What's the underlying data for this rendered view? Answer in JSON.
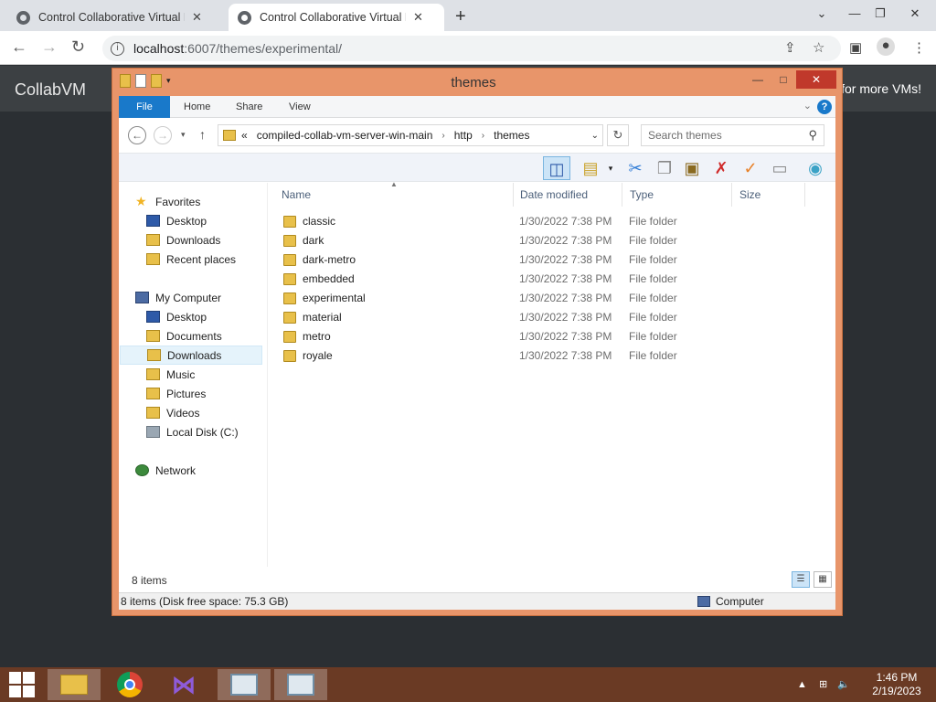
{
  "browser": {
    "tabs": [
      {
        "title": "Control Collaborative Virtual Ma",
        "close": "✕"
      },
      {
        "title": "Control Collaborative Virtual Ma",
        "close": "✕"
      }
    ],
    "new_tab": "+",
    "window_controls": [
      "⌄",
      "—",
      "❐",
      "✕"
    ],
    "url_host": "localhost",
    "url_rest": ":6007/themes/experimental/"
  },
  "site": {
    "logo": "CollabVM",
    "more_vms": "for more VMs!"
  },
  "explorer": {
    "title": "themes",
    "ribbon_tabs": [
      "File",
      "Home",
      "Share",
      "View"
    ],
    "help": "?",
    "breadcrumb": {
      "overflow": "«",
      "segments": [
        "compiled-collab-vm-server-win-main",
        "http",
        "themes"
      ]
    },
    "search_placeholder": "Search themes",
    "nav": {
      "favorites": "Favorites",
      "favorites_items": [
        "Desktop",
        "Downloads",
        "Recent places"
      ],
      "computer": "My Computer",
      "computer_items": [
        "Desktop",
        "Documents",
        "Downloads",
        "Music",
        "Pictures",
        "Videos",
        "Local Disk (C:)"
      ],
      "network": "Network"
    },
    "columns": [
      "Name",
      "Date modified",
      "Type",
      "Size"
    ],
    "files": [
      {
        "name": "classic",
        "date": "1/30/2022 7:38 PM",
        "type": "File folder"
      },
      {
        "name": "dark",
        "date": "1/30/2022 7:38 PM",
        "type": "File folder"
      },
      {
        "name": "dark-metro",
        "date": "1/30/2022 7:38 PM",
        "type": "File folder"
      },
      {
        "name": "embedded",
        "date": "1/30/2022 7:38 PM",
        "type": "File folder"
      },
      {
        "name": "experimental",
        "date": "1/30/2022 7:38 PM",
        "type": "File folder"
      },
      {
        "name": "material",
        "date": "1/30/2022 7:38 PM",
        "type": "File folder"
      },
      {
        "name": "metro",
        "date": "1/30/2022 7:38 PM",
        "type": "File folder"
      },
      {
        "name": "royale",
        "date": "1/30/2022 7:38 PM",
        "type": "File folder"
      }
    ],
    "item_count": "8 items",
    "status_left": "8 items (Disk free space: 75.3 GB)",
    "status_right": "Computer"
  },
  "taskbar": {
    "time": "1:46 PM",
    "date": "2/19/2023"
  },
  "colors": {
    "window_frame": "#e8956a",
    "file_tab": "#1979ca",
    "taskbar": "#6a3a24"
  }
}
